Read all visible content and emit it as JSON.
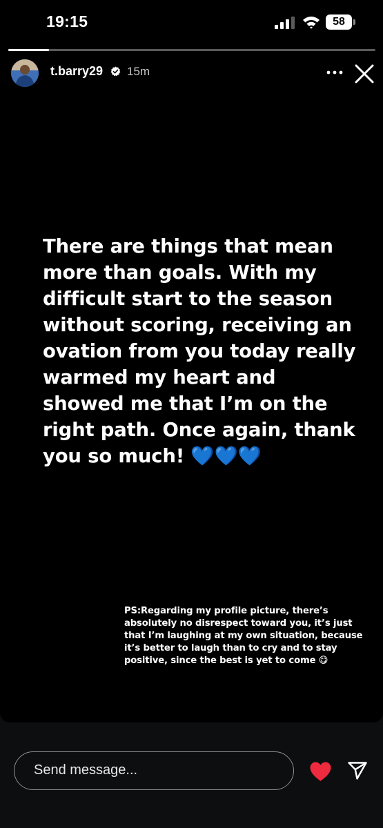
{
  "status_bar": {
    "time": "19:15",
    "battery": "58",
    "icons": [
      "signal-bars-icon",
      "wifi-icon",
      "battery-icon"
    ]
  },
  "story": {
    "progress": 0.11,
    "username": "t.barry29",
    "verified": true,
    "timestamp": "15m",
    "icons": [
      "more-options-icon",
      "close-icon"
    ],
    "main_text": "There are things that mean more than goals. With my difficult start to the season without scoring, receiving an ovation from you today really warmed my heart and showed me that I’m on the right path. Once again, thank you so much! 💙💙💙",
    "ps_text": "PS:Regarding my profile picture, there’s absolutely no disrespect toward you, it’s just that I’m laughing at my own situation, because it’s better to laugh than to cry and to stay positive, since the best is yet to come 😋"
  },
  "reply_bar": {
    "placeholder": "Send message...",
    "icons": [
      "heart-icon",
      "send-icon"
    ],
    "heart_color": "#ed2a3e"
  }
}
